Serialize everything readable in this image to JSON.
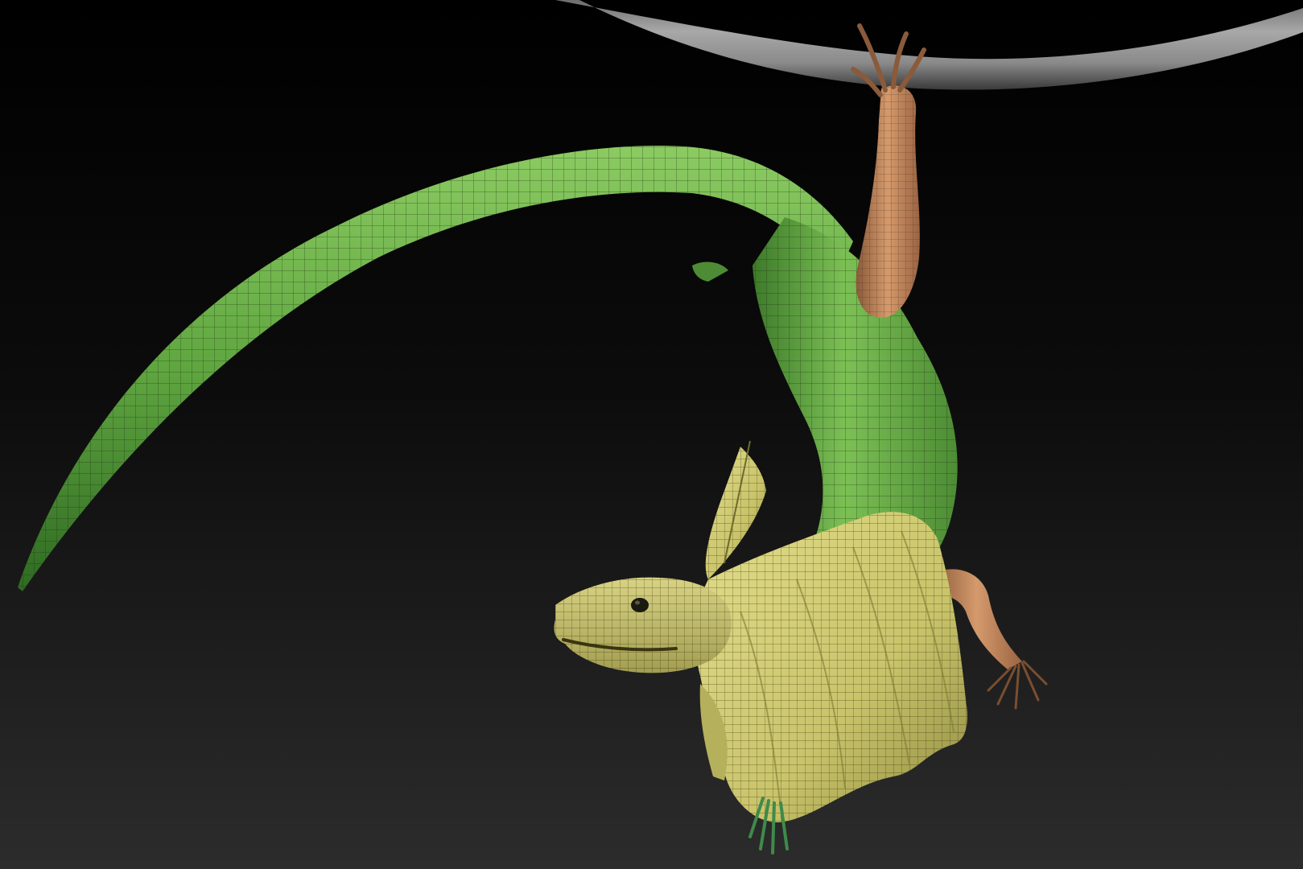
{
  "scene": {
    "subject_colors": {
      "background_top": "#000000",
      "background_bottom": "#2c2c2c",
      "branch": "#8e8e8e",
      "body_green": "#6fb34e",
      "body_green_dark": "#3f7a2a",
      "arm_skin": "#c98a5e",
      "arm_skin_dark": "#8a5a3a",
      "frill_yellow": "#d6d27a",
      "frill_dark": "#9e9a4a",
      "wire_line": "#1c2a12"
    },
    "icons": [
      "lizard-model",
      "branch"
    ]
  }
}
